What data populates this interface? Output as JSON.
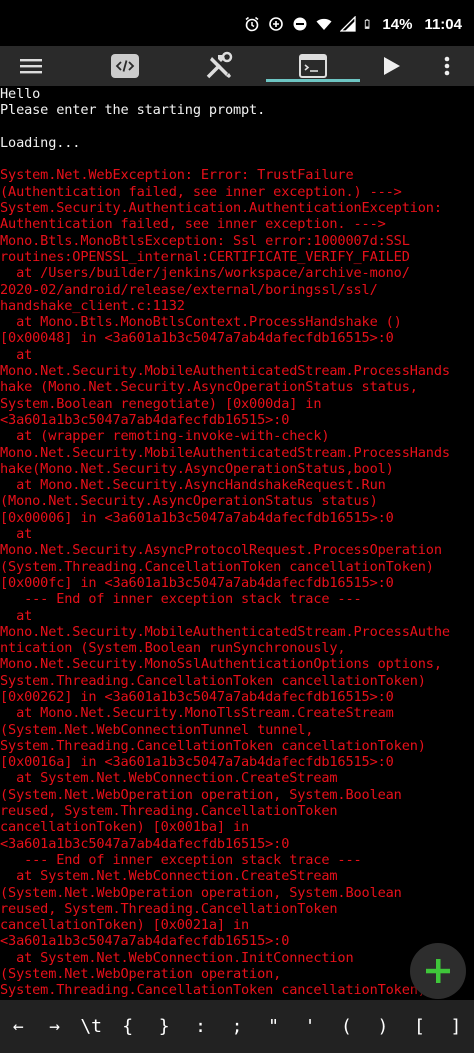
{
  "status_bar": {
    "battery": "14%",
    "time": "11:04"
  },
  "toolbar": {
    "menu_icon": "hamburger-menu-icon",
    "code_icon": "code-icon",
    "tools_icon": "tools-icon",
    "console_icon": "terminal-icon",
    "run_icon": "play-icon",
    "more_icon": "more-vert-icon",
    "accent": "#6ec6c4"
  },
  "console": {
    "lines": [
      {
        "text": "Hello",
        "c": "white"
      },
      {
        "text": "Please enter the starting prompt.",
        "c": "white"
      },
      {
        "text": "",
        "c": "white"
      },
      {
        "text": "Loading...",
        "c": "white"
      },
      {
        "text": "",
        "c": "white"
      },
      {
        "text": "System.Net.WebException: Error: TrustFailure",
        "c": "red"
      },
      {
        "text": "(Authentication failed, see inner exception.) --->",
        "c": "red"
      },
      {
        "text": "System.Security.Authentication.AuthenticationException:",
        "c": "red"
      },
      {
        "text": "Authentication failed, see inner exception. --->",
        "c": "red"
      },
      {
        "text": "Mono.Btls.MonoBtlsException: Ssl error:1000007d:SSL",
        "c": "red"
      },
      {
        "text": "routines:OPENSSL_internal:CERTIFICATE_VERIFY_FAILED",
        "c": "red"
      },
      {
        "text": "  at /Users/builder/jenkins/workspace/archive-mono/",
        "c": "red"
      },
      {
        "text": "2020-02/android/release/external/boringssl/ssl/",
        "c": "red"
      },
      {
        "text": "handshake_client.c:1132",
        "c": "red"
      },
      {
        "text": "  at Mono.Btls.MonoBtlsContext.ProcessHandshake ()",
        "c": "red"
      },
      {
        "text": "[0x00048] in <3a601a1b3c5047a7ab4dafecfdb16515>:0",
        "c": "red"
      },
      {
        "text": "  at",
        "c": "red"
      },
      {
        "text": "Mono.Net.Security.MobileAuthenticatedStream.ProcessHands",
        "c": "red"
      },
      {
        "text": "hake (Mono.Net.Security.AsyncOperationStatus status,",
        "c": "red"
      },
      {
        "text": "System.Boolean renegotiate) [0x000da] in",
        "c": "red"
      },
      {
        "text": "<3a601a1b3c5047a7ab4dafecfdb16515>:0",
        "c": "red"
      },
      {
        "text": "  at (wrapper remoting-invoke-with-check)",
        "c": "red"
      },
      {
        "text": "Mono.Net.Security.MobileAuthenticatedStream.ProcessHands",
        "c": "red"
      },
      {
        "text": "hake(Mono.Net.Security.AsyncOperationStatus,bool)",
        "c": "red"
      },
      {
        "text": "  at Mono.Net.Security.AsyncHandshakeRequest.Run",
        "c": "red"
      },
      {
        "text": "(Mono.Net.Security.AsyncOperationStatus status)",
        "c": "red"
      },
      {
        "text": "[0x00006] in <3a601a1b3c5047a7ab4dafecfdb16515>:0",
        "c": "red"
      },
      {
        "text": "  at",
        "c": "red"
      },
      {
        "text": "Mono.Net.Security.AsyncProtocolRequest.ProcessOperation",
        "c": "red"
      },
      {
        "text": "(System.Threading.CancellationToken cancellationToken)",
        "c": "red"
      },
      {
        "text": "[0x000fc] in <3a601a1b3c5047a7ab4dafecfdb16515>:0",
        "c": "red"
      },
      {
        "text": "   --- End of inner exception stack trace ---",
        "c": "red"
      },
      {
        "text": "  at",
        "c": "red"
      },
      {
        "text": "Mono.Net.Security.MobileAuthenticatedStream.ProcessAuthe",
        "c": "red"
      },
      {
        "text": "ntication (System.Boolean runSynchronously,",
        "c": "red"
      },
      {
        "text": "Mono.Net.Security.MonoSslAuthenticationOptions options,",
        "c": "red"
      },
      {
        "text": "System.Threading.CancellationToken cancellationToken)",
        "c": "red"
      },
      {
        "text": "[0x00262] in <3a601a1b3c5047a7ab4dafecfdb16515>:0",
        "c": "red"
      },
      {
        "text": "  at Mono.Net.Security.MonoTlsStream.CreateStream",
        "c": "red"
      },
      {
        "text": "(System.Net.WebConnectionTunnel tunnel,",
        "c": "red"
      },
      {
        "text": "System.Threading.CancellationToken cancellationToken)",
        "c": "red"
      },
      {
        "text": "[0x0016a] in <3a601a1b3c5047a7ab4dafecfdb16515>:0",
        "c": "red"
      },
      {
        "text": "  at System.Net.WebConnection.CreateStream",
        "c": "red"
      },
      {
        "text": "(System.Net.WebOperation operation, System.Boolean",
        "c": "red"
      },
      {
        "text": "reused, System.Threading.CancellationToken",
        "c": "red"
      },
      {
        "text": "cancellationToken) [0x001ba] in",
        "c": "red"
      },
      {
        "text": "<3a601a1b3c5047a7ab4dafecfdb16515>:0",
        "c": "red"
      },
      {
        "text": "   --- End of inner exception stack trace ---",
        "c": "red"
      },
      {
        "text": "  at System.Net.WebConnection.CreateStream",
        "c": "red"
      },
      {
        "text": "(System.Net.WebOperation operation, System.Boolean",
        "c": "red"
      },
      {
        "text": "reused, System.Threading.CancellationToken",
        "c": "red"
      },
      {
        "text": "cancellationToken) [0x0021a] in",
        "c": "red"
      },
      {
        "text": "<3a601a1b3c5047a7ab4dafecfdb16515>:0",
        "c": "red"
      },
      {
        "text": "  at System.Net.WebConnection.InitConnection",
        "c": "red"
      },
      {
        "text": "(System.Net.WebOperation operation,",
        "c": "red"
      },
      {
        "text": "System.Threading.CancellationToken cancellationToken)",
        "c": "red"
      }
    ]
  },
  "fab": {
    "icon": "add-icon",
    "color": "#3fc63a"
  },
  "keys": [
    "←",
    "→",
    "\\t",
    "{",
    "}",
    ":",
    ";",
    "\"",
    "'",
    "(",
    ")",
    "[",
    "]"
  ]
}
